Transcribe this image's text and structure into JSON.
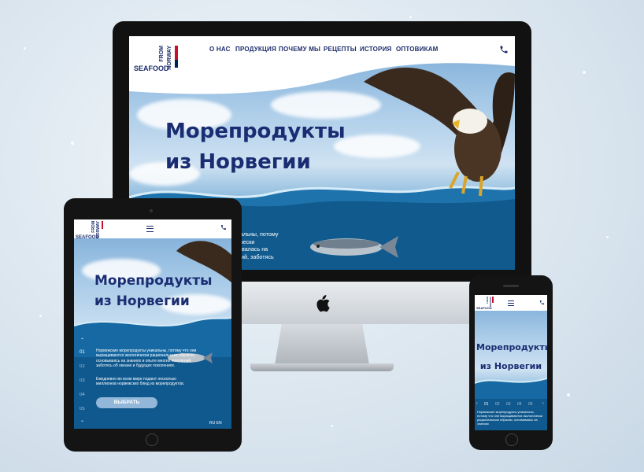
{
  "brand": {
    "line1": "FROM",
    "line2": "NORWAY",
    "line3": "SEAFOOD"
  },
  "desktop": {
    "nav": [
      "О НАС",
      "ПРОДУКЦИЯ",
      "ПОЧЕМУ МЫ",
      "РЕЦЕПТЫ",
      "ИСТОРИЯ",
      "ОПТОВИКАМ"
    ],
    "hero_line1": "Морепродукты",
    "hero_line2": "из Норвегии",
    "body_lines": [
      "уникальны, потому",
      "логически",
      "новывалась на",
      "олений, заботясь",
      "ених."
    ]
  },
  "tablet": {
    "hero_line1": "Морепродукты",
    "hero_line2": "из Норвегии",
    "pages": [
      "01",
      "02",
      "03",
      "04",
      "05"
    ],
    "body": "Норвежские морепродукты уникальны, потому что они выращиваются экологически рациональным образом, основываясь на знаниях и опыте многих поколений, заботясь об океане и будущих поколениях.",
    "body2": "Ежедневно во всем мире подают несколько миллионов норвежских блюд из морепродуктов.",
    "button": "ВЫБРАТЬ",
    "lang": "RU EN"
  },
  "phone": {
    "hero_line1": "Морепродукты",
    "hero_line2": "из Норвегии",
    "pages": [
      "01",
      "02",
      "03",
      "04",
      "05"
    ],
    "body": "Норвежские морепродукты уникальны, потому что они выращиваются экологически рациональным образом, основываясь на знаниях"
  },
  "colors": {
    "navy": "#1d2e6b",
    "flag_red": "#c8102e",
    "flag_blue": "#00205b",
    "sea": "#0f5e94"
  }
}
